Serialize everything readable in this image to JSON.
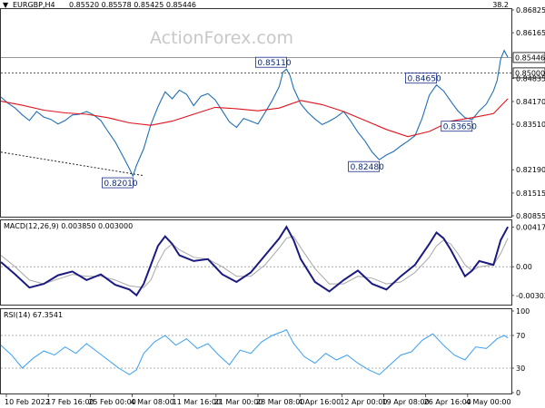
{
  "header": {
    "arrow": "▼",
    "symbol": "EURGBP,H4",
    "ohlc": "0.85520 0.85578 0.85425 0.85446",
    "corner_value": "38.2"
  },
  "watermark": "ActionForex.com",
  "colors": {
    "price": "#1f6fb5",
    "ma": "#e0141e",
    "macd": "#1a1a80",
    "signal": "#a8a8a8",
    "rsi": "#3aa0f0",
    "label_border": "#1a2a8a",
    "label_text": "#0a2a7a"
  },
  "chart_data": [
    {
      "type": "line",
      "panel": "price",
      "ylim": [
        0.80855,
        0.86825
      ],
      "y_ticks": [
        "0.86825",
        "0.86165",
        "0.85446",
        "0.85000",
        "0.84835",
        "0.84170",
        "0.83510",
        "0.82190",
        "0.81515",
        "0.80855"
      ],
      "current_price_label": "0.85446",
      "level_label": "0.85000",
      "annotations": [
        "0.85110",
        "0.84650",
        "0.83650",
        "0.82480",
        "0.82010"
      ],
      "x_ticks": [
        "10 Feb 2022",
        "17 Feb 16:00",
        "25 Feb 00:00",
        "4 Mar 08:00",
        "11 Mar 16:00",
        "21 Mar 00:00",
        "28 Mar 08:00",
        "4 Apr 16:00",
        "12 Apr 00:00",
        "19 Apr 08:00",
        "26 Apr 16:00",
        "4 May 00:00"
      ],
      "series": [
        {
          "kind": "price",
          "points": [
            [
              0,
              0.843
            ],
            [
              2,
              0.8412
            ],
            [
              4,
              0.8398
            ],
            [
              6,
              0.8378
            ],
            [
              8,
              0.8362
            ],
            [
              10,
              0.8388
            ],
            [
              12,
              0.8372
            ],
            [
              14,
              0.8365
            ],
            [
              16,
              0.8352
            ],
            [
              18,
              0.8362
            ],
            [
              20,
              0.8378
            ],
            [
              22,
              0.838
            ],
            [
              24,
              0.8388
            ],
            [
              26,
              0.8378
            ],
            [
              28,
              0.8362
            ],
            [
              30,
              0.833
            ],
            [
              32,
              0.83
            ],
            [
              34,
              0.8262
            ],
            [
              36,
              0.8222
            ],
            [
              37,
              0.8201
            ],
            [
              38,
              0.8232
            ],
            [
              40,
              0.828
            ],
            [
              42,
              0.835
            ],
            [
              44,
              0.8402
            ],
            [
              46,
              0.8445
            ],
            [
              48,
              0.8425
            ],
            [
              50,
              0.845
            ],
            [
              52,
              0.8438
            ],
            [
              54,
              0.8405
            ],
            [
              56,
              0.8432
            ],
            [
              58,
              0.844
            ],
            [
              60,
              0.8422
            ],
            [
              62,
              0.839
            ],
            [
              64,
              0.8358
            ],
            [
              66,
              0.8342
            ],
            [
              68,
              0.8368
            ],
            [
              70,
              0.836
            ],
            [
              72,
              0.8352
            ],
            [
              74,
              0.8385
            ],
            [
              76,
              0.842
            ],
            [
              78,
              0.8461
            ],
            [
              79,
              0.8502
            ],
            [
              80,
              0.8511
            ],
            [
              81,
              0.8492
            ],
            [
              82,
              0.8455
            ],
            [
              84,
              0.841
            ],
            [
              86,
              0.8385
            ],
            [
              88,
              0.8366
            ],
            [
              90,
              0.835
            ],
            [
              92,
              0.836
            ],
            [
              94,
              0.8372
            ],
            [
              96,
              0.8388
            ],
            [
              98,
              0.836
            ],
            [
              100,
              0.8328
            ],
            [
              102,
              0.8302
            ],
            [
              104,
              0.827
            ],
            [
              106,
              0.8248
            ],
            [
              108,
              0.8262
            ],
            [
              110,
              0.8272
            ],
            [
              112,
              0.8288
            ],
            [
              114,
              0.8302
            ],
            [
              116,
              0.8318
            ],
            [
              118,
              0.8368
            ],
            [
              120,
              0.8435
            ],
            [
              122,
              0.8465
            ],
            [
              124,
              0.8448
            ],
            [
              126,
              0.8418
            ],
            [
              128,
              0.839
            ],
            [
              130,
              0.837
            ],
            [
              132,
              0.8365
            ],
            [
              134,
              0.839
            ],
            [
              136,
              0.841
            ],
            [
              138,
              0.8448
            ],
            [
              139,
              0.8478
            ],
            [
              140,
              0.854
            ],
            [
              141,
              0.8565
            ],
            [
              142,
              0.8545
            ]
          ]
        },
        {
          "kind": "ma",
          "points": [
            [
              0,
              0.8418
            ],
            [
              6,
              0.8406
            ],
            [
              12,
              0.8392
            ],
            [
              18,
              0.8384
            ],
            [
              24,
              0.838
            ],
            [
              30,
              0.837
            ],
            [
              36,
              0.8355
            ],
            [
              42,
              0.8348
            ],
            [
              48,
              0.836
            ],
            [
              54,
              0.838
            ],
            [
              60,
              0.84
            ],
            [
              66,
              0.8396
            ],
            [
              72,
              0.839
            ],
            [
              78,
              0.8398
            ],
            [
              84,
              0.842
            ],
            [
              90,
              0.8408
            ],
            [
              96,
              0.8388
            ],
            [
              102,
              0.8362
            ],
            [
              108,
              0.8336
            ],
            [
              114,
              0.8315
            ],
            [
              120,
              0.833
            ],
            [
              126,
              0.836
            ],
            [
              132,
              0.837
            ],
            [
              138,
              0.8382
            ],
            [
              142,
              0.8425
            ]
          ]
        },
        {
          "kind": "trendline",
          "points": [
            [
              0,
              0.827
            ],
            [
              40,
              0.8202
            ]
          ]
        }
      ]
    },
    {
      "type": "line",
      "panel": "macd",
      "label": "MACD(12,26,9) 0.003850 0.003000",
      "ylim": [
        -0.0038,
        0.0047
      ],
      "y_ticks": [
        "0.004177",
        "0.00",
        "-0.003022"
      ],
      "series": [
        {
          "kind": "macd",
          "points": [
            [
              0,
              0.0005
            ],
            [
              4,
              -0.0008
            ],
            [
              8,
              -0.0022
            ],
            [
              12,
              -0.0018
            ],
            [
              16,
              -0.0009
            ],
            [
              20,
              -0.0005
            ],
            [
              24,
              -0.0014
            ],
            [
              28,
              -0.0008
            ],
            [
              32,
              -0.0019
            ],
            [
              36,
              -0.0024
            ],
            [
              38,
              -0.003
            ],
            [
              40,
              -0.0018
            ],
            [
              42,
              0.0002
            ],
            [
              44,
              0.0022
            ],
            [
              46,
              0.0032
            ],
            [
              48,
              0.0024
            ],
            [
              50,
              0.0012
            ],
            [
              54,
              0.0006
            ],
            [
              58,
              0.0008
            ],
            [
              62,
              -0.0008
            ],
            [
              66,
              -0.0016
            ],
            [
              70,
              -0.0006
            ],
            [
              74,
              0.0012
            ],
            [
              78,
              0.003
            ],
            [
              80,
              0.0042
            ],
            [
              82,
              0.0028
            ],
            [
              84,
              0.0008
            ],
            [
              88,
              -0.0016
            ],
            [
              92,
              -0.0026
            ],
            [
              96,
              -0.0014
            ],
            [
              100,
              -0.0004
            ],
            [
              104,
              -0.0018
            ],
            [
              108,
              -0.0024
            ],
            [
              112,
              -0.001
            ],
            [
              116,
              0.0002
            ],
            [
              120,
              0.0024
            ],
            [
              122,
              0.0036
            ],
            [
              124,
              0.003
            ],
            [
              126,
              0.0018
            ],
            [
              128,
              0.0004
            ],
            [
              130,
              -0.001
            ],
            [
              132,
              -0.0004
            ],
            [
              134,
              0.0006
            ],
            [
              138,
              0.0002
            ],
            [
              140,
              0.0028
            ],
            [
              142,
              0.0042
            ]
          ]
        },
        {
          "kind": "signal",
          "points": [
            [
              0,
              0.0012
            ],
            [
              4,
              0.0
            ],
            [
              8,
              -0.0014
            ],
            [
              12,
              -0.0018
            ],
            [
              16,
              -0.0013
            ],
            [
              20,
              -0.0008
            ],
            [
              24,
              -0.001
            ],
            [
              28,
              -0.001
            ],
            [
              32,
              -0.0014
            ],
            [
              36,
              -0.002
            ],
            [
              40,
              -0.0022
            ],
            [
              42,
              -0.0014
            ],
            [
              44,
              0.0004
            ],
            [
              46,
              0.0018
            ],
            [
              48,
              0.0024
            ],
            [
              50,
              0.0018
            ],
            [
              54,
              0.001
            ],
            [
              58,
              0.0008
            ],
            [
              62,
              0.0
            ],
            [
              66,
              -0.001
            ],
            [
              70,
              -0.001
            ],
            [
              74,
              0.0002
            ],
            [
              78,
              0.002
            ],
            [
              80,
              0.003
            ],
            [
              82,
              0.0032
            ],
            [
              84,
              0.002
            ],
            [
              88,
              -0.0002
            ],
            [
              92,
              -0.0018
            ],
            [
              96,
              -0.0018
            ],
            [
              100,
              -0.001
            ],
            [
              104,
              -0.0012
            ],
            [
              108,
              -0.0018
            ],
            [
              112,
              -0.0016
            ],
            [
              116,
              -0.0006
            ],
            [
              120,
              0.001
            ],
            [
              122,
              0.0022
            ],
            [
              124,
              0.0028
            ],
            [
              126,
              0.0024
            ],
            [
              128,
              0.0014
            ],
            [
              130,
              0.0002
            ],
            [
              132,
              -0.0004
            ],
            [
              134,
              0.0
            ],
            [
              138,
              0.0002
            ],
            [
              140,
              0.0014
            ],
            [
              142,
              0.003
            ]
          ]
        }
      ]
    },
    {
      "type": "line",
      "panel": "rsi",
      "label": "RSI(14) 67.3541",
      "ylim": [
        0,
        100
      ],
      "y_ticks": [
        "100",
        "70",
        "30",
        "0"
      ],
      "levels": [
        70,
        30
      ],
      "series": [
        {
          "kind": "rsi",
          "points": [
            [
              0,
              58
            ],
            [
              3,
              46
            ],
            [
              6,
              30
            ],
            [
              9,
              42
            ],
            [
              12,
              51
            ],
            [
              15,
              46
            ],
            [
              18,
              56
            ],
            [
              21,
              48
            ],
            [
              24,
              60
            ],
            [
              27,
              50
            ],
            [
              30,
              40
            ],
            [
              33,
              30
            ],
            [
              36,
              22
            ],
            [
              38,
              28
            ],
            [
              40,
              48
            ],
            [
              43,
              62
            ],
            [
              46,
              70
            ],
            [
              49,
              58
            ],
            [
              52,
              66
            ],
            [
              55,
              54
            ],
            [
              58,
              60
            ],
            [
              61,
              46
            ],
            [
              64,
              34
            ],
            [
              67,
              52
            ],
            [
              70,
              48
            ],
            [
              73,
              62
            ],
            [
              76,
              70
            ],
            [
              79,
              75
            ],
            [
              80,
              77
            ],
            [
              82,
              60
            ],
            [
              85,
              44
            ],
            [
              88,
              36
            ],
            [
              91,
              48
            ],
            [
              94,
              40
            ],
            [
              97,
              46
            ],
            [
              100,
              36
            ],
            [
              103,
              28
            ],
            [
              106,
              22
            ],
            [
              109,
              34
            ],
            [
              112,
              46
            ],
            [
              115,
              50
            ],
            [
              118,
              64
            ],
            [
              121,
              72
            ],
            [
              124,
              58
            ],
            [
              127,
              46
            ],
            [
              130,
              40
            ],
            [
              133,
              56
            ],
            [
              136,
              54
            ],
            [
              139,
              66
            ],
            [
              141,
              70
            ],
            [
              142,
              67
            ]
          ]
        }
      ]
    }
  ]
}
